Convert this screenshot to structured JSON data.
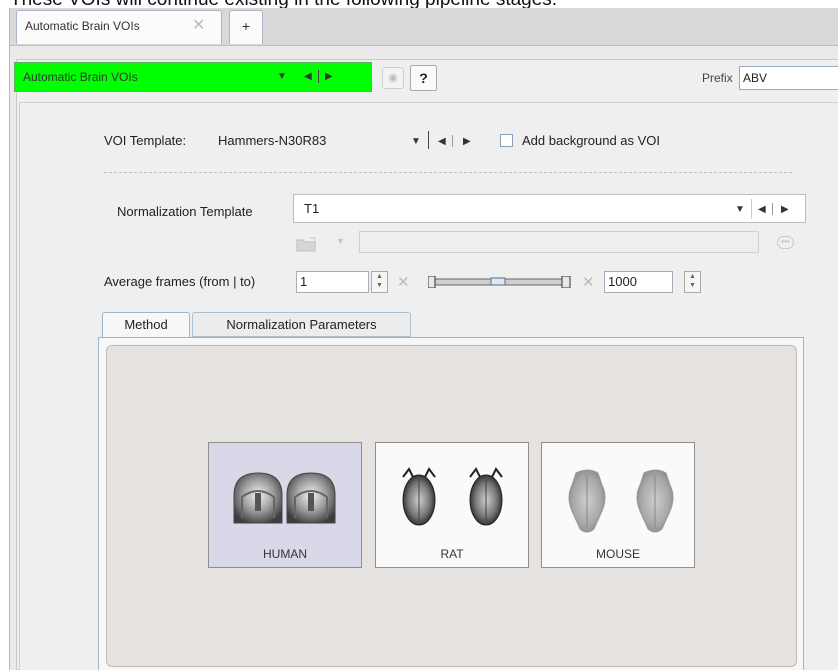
{
  "caption": "These VOIs will continue existing in the following pipeline stages.",
  "tabs": {
    "main_label": "Automatic Brain VOIs",
    "close_glyph": "✕",
    "add_glyph": "+"
  },
  "stage": {
    "name": "Automatic Brain VOIs",
    "color": "#00ff00",
    "help_label": "?",
    "prefix_label": "Prefix",
    "prefix_value": "ABV"
  },
  "voi_template": {
    "label": "VOI Template:",
    "value": "Hammers-N30R83",
    "background_label": "Add background as VOI",
    "background_checked": false
  },
  "normalization": {
    "label": "Normalization Template",
    "value": "T1"
  },
  "average_frames": {
    "label": "Average frames (from | to)",
    "from": "1",
    "to": "1000"
  },
  "method_tabs": [
    "Method",
    "Normalization Parameters"
  ],
  "species": [
    {
      "label": "HUMAN",
      "selected": true
    },
    {
      "label": "RAT",
      "selected": false
    },
    {
      "label": "MOUSE",
      "selected": false
    }
  ]
}
